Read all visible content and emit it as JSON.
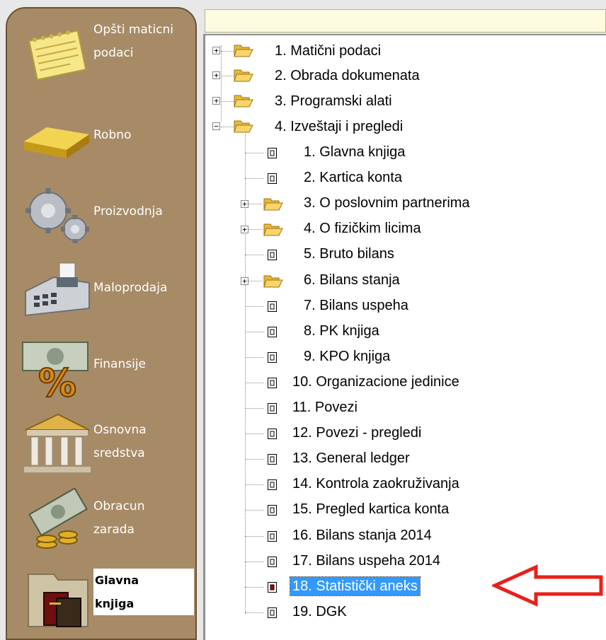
{
  "sidebar": {
    "modules": [
      {
        "label_lines": [
          "Opšti maticni",
          "podaci"
        ],
        "icon": "notepad-icon",
        "active": false
      },
      {
        "label_lines": [
          "Robno"
        ],
        "icon": "gold-bar-icon",
        "active": false
      },
      {
        "label_lines": [
          "Proizvodnja"
        ],
        "icon": "gears-icon",
        "active": false
      },
      {
        "label_lines": [
          "Maloprodaja"
        ],
        "icon": "cash-register-icon",
        "active": false
      },
      {
        "label_lines": [
          "Finansije"
        ],
        "icon": "money-percent-icon",
        "active": false
      },
      {
        "label_lines": [
          "Osnovna",
          "sredstva"
        ],
        "icon": "bank-building-icon",
        "active": false
      },
      {
        "label_lines": [
          "Obracun",
          "zarada"
        ],
        "icon": "money-coins-icon",
        "active": false
      },
      {
        "label_lines": [
          "Glavna",
          "knjiga"
        ],
        "icon": "ledger-books-icon",
        "active": true
      }
    ]
  },
  "tree": {
    "roots": [
      {
        "label": "1. Matični podaci",
        "expanded": false
      },
      {
        "label": "2. Obrada dokumenata",
        "expanded": false
      },
      {
        "label": "3. Programski alati",
        "expanded": false
      },
      {
        "label": "4. Izveštaji i pregledi",
        "expanded": true
      }
    ],
    "children": [
      {
        "label": "1. Glavna knjiga",
        "type": "report"
      },
      {
        "label": "2. Kartica konta",
        "type": "report"
      },
      {
        "label": "3. O poslovnim partnerima",
        "type": "folder"
      },
      {
        "label": "4. O fizičkim licima",
        "type": "folder"
      },
      {
        "label": "5. Bruto bilans",
        "type": "report"
      },
      {
        "label": "6. Bilans stanja",
        "type": "folder"
      },
      {
        "label": "7. Bilans uspeha",
        "type": "report"
      },
      {
        "label": "8. PK knjiga",
        "type": "report"
      },
      {
        "label": "9. KPO knjiga",
        "type": "report"
      },
      {
        "label": "10. Organizacione jedinice",
        "type": "report"
      },
      {
        "label": "11. Povezi",
        "type": "report"
      },
      {
        "label": "12. Povezi - pregledi",
        "type": "report"
      },
      {
        "label": "13. General ledger",
        "type": "report"
      },
      {
        "label": "14. Kontrola zaokruživanja",
        "type": "report"
      },
      {
        "label": "15. Pregled kartica konta",
        "type": "report"
      },
      {
        "label": "16. Bilans stanja 2014",
        "type": "report"
      },
      {
        "label": "17. Bilans uspeha 2014",
        "type": "report"
      },
      {
        "label": "18. Statistički aneks",
        "type": "report",
        "selected": true
      },
      {
        "label": "19. DGK",
        "type": "report"
      }
    ],
    "expand_symbol": "+",
    "collapse_symbol": "−"
  },
  "colors": {
    "sidebar_bg": "#a78b67",
    "selection": "#3399ff",
    "arrow": "#e8201a"
  }
}
